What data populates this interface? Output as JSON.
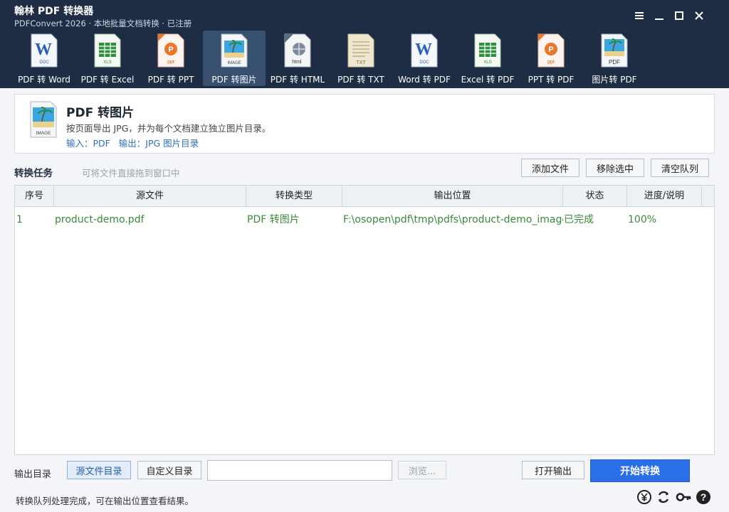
{
  "window": {
    "title": "翰林 PDF 转换器",
    "subtitle": "PDFConvert 2026 · 本地批量文档转换 · 已注册"
  },
  "toolbar": {
    "items": [
      {
        "label": "PDF 转 Word",
        "icon": "word-doc-icon",
        "badge": "DOC"
      },
      {
        "label": "PDF 转 Excel",
        "icon": "excel-xls-icon",
        "badge": "XLS"
      },
      {
        "label": "PDF 转 PPT",
        "icon": "ppt-icon",
        "badge": "ppt"
      },
      {
        "label": "PDF 转图片",
        "icon": "image-icon",
        "badge": "IMAGE",
        "active": true
      },
      {
        "label": "PDF 转 HTML",
        "icon": "html-icon",
        "badge": "html"
      },
      {
        "label": "PDF 转 TXT",
        "icon": "txt-icon",
        "badge": "TXT"
      },
      {
        "label": "Word 转 PDF",
        "icon": "word-doc-icon",
        "badge": "DOC"
      },
      {
        "label": "Excel 转 PDF",
        "icon": "excel-xls-icon",
        "badge": "XLS"
      },
      {
        "label": "PPT 转 PDF",
        "icon": "ppt-icon",
        "badge": "ppt"
      },
      {
        "label": "图片转 PDF",
        "icon": "pdf-image-icon",
        "badge": "PDF"
      }
    ]
  },
  "info": {
    "title": "PDF 转图片",
    "description": "按页面导出 JPG，并为每个文档建立独立图片目录。",
    "io": "输入：PDF   输出：JPG 图片目录",
    "icon_badge": "IMAGE"
  },
  "tasks": {
    "label": "转换任务",
    "hint": "可将文件直接拖到窗口中",
    "add_label": "添加文件",
    "remove_label": "移除选中",
    "clear_label": "清空队列"
  },
  "table": {
    "columns": [
      "序号",
      "源文件",
      "转换类型",
      "输出位置",
      "状态",
      "进度/说明"
    ],
    "rows": [
      {
        "index": "1",
        "file": "product-demo.pdf",
        "type": "PDF 转图片",
        "output": "F:\\osopen\\pdf\\tmp\\pdfs\\product-demo_images",
        "status": "已完成",
        "progress": "100%"
      }
    ]
  },
  "output": {
    "label": "输出目录",
    "src_dir_label": "源文件目录",
    "custom_dir_label": "自定义目录",
    "path_value": "",
    "browse_label": "浏览...",
    "open_label": "打开输出",
    "start_label": "开始转换"
  },
  "status": {
    "text": "转换队列处理完成，可在输出位置查看结果。"
  },
  "colors": {
    "header_bg": "#1e2d44",
    "accent": "#2a6ee8",
    "success_text": "#3a8a3a",
    "link_text": "#2f6fbd"
  }
}
